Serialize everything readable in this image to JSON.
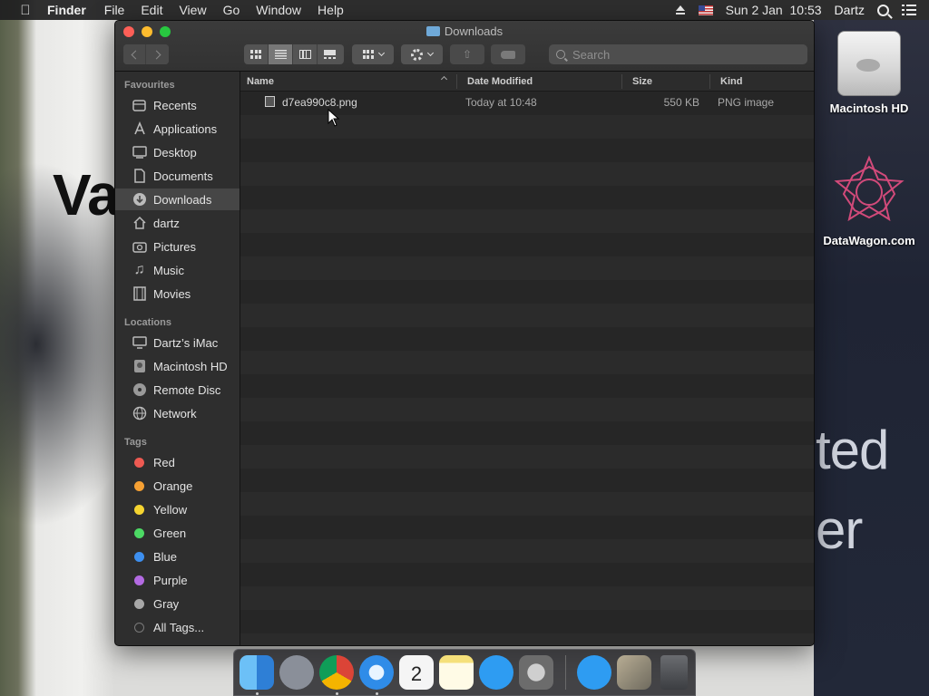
{
  "menubar": {
    "app_name": "Finder",
    "items": [
      "File",
      "Edit",
      "View",
      "Go",
      "Window",
      "Help"
    ],
    "clock": "Sun 2 Jan  10:53",
    "user": "Dartz"
  },
  "window": {
    "title": "Downloads",
    "search": {
      "placeholder": "Search",
      "value": ""
    }
  },
  "sidebar": {
    "favourites_header": "Favourites",
    "favourites": [
      {
        "label": "Recents",
        "icon": "clock-icon"
      },
      {
        "label": "Applications",
        "icon": "applications-icon"
      },
      {
        "label": "Desktop",
        "icon": "desktop-icon"
      },
      {
        "label": "Documents",
        "icon": "documents-icon"
      },
      {
        "label": "Downloads",
        "icon": "downloads-icon",
        "selected": true
      },
      {
        "label": "dartz",
        "icon": "home-icon"
      },
      {
        "label": "Pictures",
        "icon": "camera-icon"
      },
      {
        "label": "Music",
        "icon": "music-icon"
      },
      {
        "label": "Movies",
        "icon": "film-icon"
      }
    ],
    "locations_header": "Locations",
    "locations": [
      {
        "label": "Dartz’s iMac",
        "icon": "imac-icon"
      },
      {
        "label": "Macintosh HD",
        "icon": "disk-icon"
      },
      {
        "label": "Remote Disc",
        "icon": "disc-icon"
      },
      {
        "label": "Network",
        "icon": "globe-icon"
      }
    ],
    "tags_header": "Tags",
    "tags": [
      {
        "label": "Red",
        "color": "#ee5a52"
      },
      {
        "label": "Orange",
        "color": "#f5a033"
      },
      {
        "label": "Yellow",
        "color": "#f5d430"
      },
      {
        "label": "Green",
        "color": "#4cd964"
      },
      {
        "label": "Blue",
        "color": "#3d8fef"
      },
      {
        "label": "Purple",
        "color": "#b36ae2"
      },
      {
        "label": "Gray",
        "color": "#a8a8a8"
      },
      {
        "label": "All Tags...",
        "color": ""
      }
    ]
  },
  "columns": {
    "name": "Name",
    "date": "Date Modified",
    "size": "Size",
    "kind": "Kind"
  },
  "files": [
    {
      "name": "d7ea990c8.png",
      "date": "Today at 10:48",
      "size": "550 KB",
      "kind": "PNG image"
    }
  ],
  "desktop": {
    "icons": [
      {
        "label": "Macintosh HD",
        "icon": "hard-drive-icon"
      },
      {
        "label": "DataWagon.com",
        "icon": "star-logo-icon"
      }
    ],
    "wallpaper_text": [
      "Va",
      "ted",
      "er"
    ]
  },
  "dock": {
    "apps": [
      {
        "name": "finder-icon",
        "color": "#3b8fe0"
      },
      {
        "name": "launchpad-icon",
        "color": "#8a8f99"
      },
      {
        "name": "chrome-icon",
        "color": "#e6e6e6"
      },
      {
        "name": "safari-icon",
        "color": "#2f8ce8"
      },
      {
        "name": "calendar-icon",
        "color": "#f5f5f5"
      },
      {
        "name": "notes-icon",
        "color": "#f5e07a"
      },
      {
        "name": "app-store-icon",
        "color": "#2e9cf2"
      },
      {
        "name": "system-preferences-icon",
        "color": "#8c8c8c"
      },
      {
        "name": "app-store-folder-icon",
        "color": "#2e9cf2"
      },
      {
        "name": "image-stack-icon",
        "color": "#9a9280"
      },
      {
        "name": "trash-icon",
        "color": "#5c5e62"
      }
    ],
    "calendar_day": "2"
  }
}
